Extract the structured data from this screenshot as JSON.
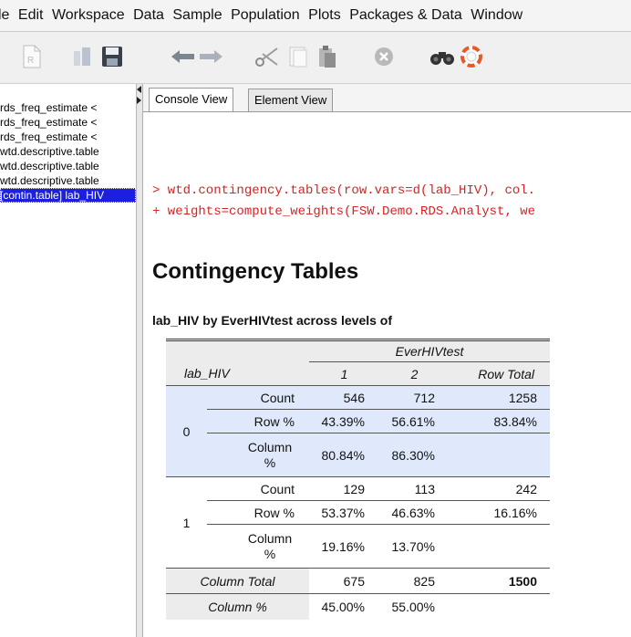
{
  "menu": {
    "items": [
      "le",
      "Edit",
      "Workspace",
      "Data",
      "Sample",
      "Population",
      "Plots",
      "Packages & Data",
      "Window"
    ]
  },
  "toolbar": {
    "icons": [
      "r-script-icon",
      "open-folder-icon",
      "save-icon",
      "undo-icon",
      "redo-icon",
      "cut-icon",
      "copy-icon",
      "paste-icon",
      "stop-icon",
      "binoculars-icon",
      "help-icon"
    ]
  },
  "sidebar": {
    "items": [
      "rds_freq_estimate <",
      "rds_freq_estimate <",
      "rds_freq_estimate <",
      "wtd.descriptive.table",
      "wtd.descriptive.table",
      "wtd.descriptive.table",
      "[contin.table] lab_HIV"
    ],
    "selected_index": 6
  },
  "tabs": [
    {
      "label": "Console View",
      "active": true
    },
    {
      "label": "Element View",
      "active": false
    }
  ],
  "console": {
    "command_line1": "> wtd.contingency.tables(row.vars=d(lab_HIV), col.",
    "command_line2": "+ weights=compute_weights(FSW.Demo.RDS.Analyst, we",
    "heading": "Contingency Tables",
    "subheading": "lab_HIV by EverHIVtest across levels of"
  },
  "table": {
    "col_var": "EverHIVtest",
    "row_var": "lab_HIV",
    "col_headers": [
      "1",
      "2",
      "Row Total"
    ],
    "groups": [
      {
        "level": "0",
        "rows": [
          {
            "stat": "Count",
            "values": [
              "546",
              "712",
              "1258"
            ]
          },
          {
            "stat": "Row %",
            "values": [
              "43.39%",
              "56.61%",
              "83.84%"
            ]
          },
          {
            "stat": "Column %",
            "values": [
              "80.84%",
              "86.30%",
              ""
            ]
          }
        ]
      },
      {
        "level": "1",
        "rows": [
          {
            "stat": "Count",
            "values": [
              "129",
              "113",
              "242"
            ]
          },
          {
            "stat": "Row %",
            "values": [
              "53.37%",
              "46.63%",
              "16.16%"
            ]
          },
          {
            "stat": "Column %",
            "values": [
              "19.16%",
              "13.70%",
              ""
            ]
          }
        ]
      }
    ],
    "col_total": {
      "label": "Column Total",
      "values": [
        "675",
        "825",
        "1500"
      ]
    },
    "col_pct": {
      "label": "Column %",
      "values": [
        "45.00%",
        "55.00%",
        ""
      ]
    }
  },
  "colors": {
    "command_text": "#d42424",
    "group0_background": "#dfe9fb",
    "selection": "#1c1ee0"
  }
}
